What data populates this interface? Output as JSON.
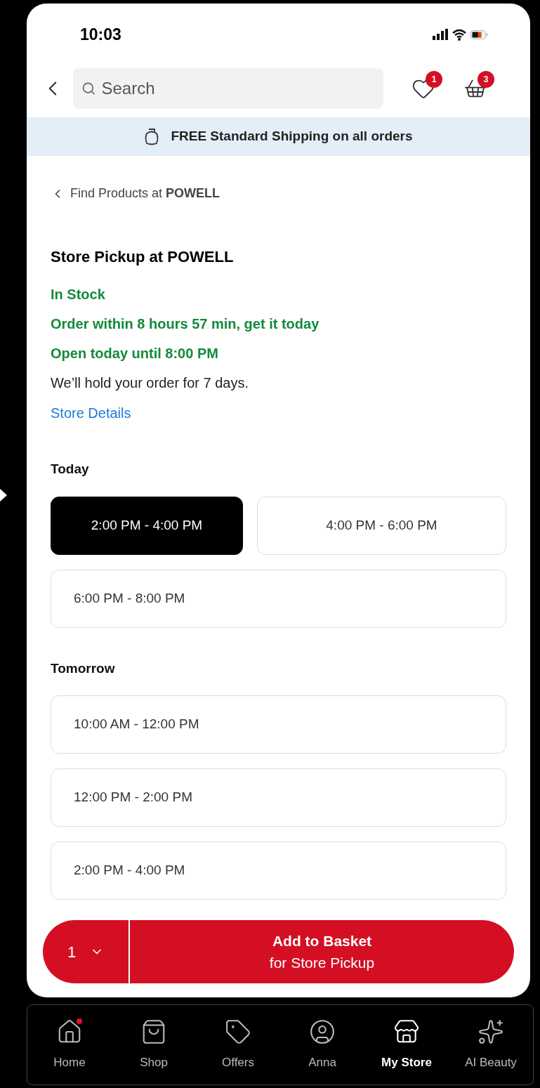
{
  "status_bar": {
    "time": "10:03"
  },
  "header": {
    "search": {
      "placeholder": "Search"
    },
    "wishlist_count": "1",
    "basket_count": "3"
  },
  "banner": {
    "text": "FREE Standard Shipping on all orders"
  },
  "breadcrumb": {
    "text": "Find Products at **POWELL**"
  },
  "pickup": {
    "title": "Store Pickup at POWELL",
    "lines": [
      {
        "text": "In Stock",
        "kind": "status"
      },
      {
        "text": "Order within 8 hours 57 min, get it today",
        "kind": "status"
      },
      {
        "text": "Open today until 8:00 PM",
        "kind": "status"
      },
      {
        "text": "We’ll hold your order for 7 days.",
        "kind": "note"
      }
    ],
    "link": "Store Details"
  },
  "days": [
    {
      "label": "Today",
      "slots": [
        {
          "label": "2:00 PM - 4:00 PM",
          "selected": true
        },
        {
          "label": "4:00 PM - 6:00 PM",
          "selected": false
        },
        {
          "label": "6:00 PM - 8:00 PM",
          "selected": false
        }
      ]
    },
    {
      "label": "Tomorrow",
      "slots": [
        {
          "label": "10:00 AM - 12:00 PM",
          "selected": false
        },
        {
          "label": "12:00 PM - 2:00 PM",
          "selected": false
        },
        {
          "label": "2:00 PM - 4:00 PM",
          "selected": false
        }
      ]
    }
  ],
  "action": {
    "quantity": "1",
    "button_line_1": "Add to Basket",
    "button_line_2": "for Store Pickup"
  },
  "tab_bar": [
    {
      "label": "Home",
      "selected": false,
      "notification": true
    },
    {
      "label": "Shop",
      "selected": false,
      "notification": false
    },
    {
      "label": "Offers",
      "selected": false,
      "notification": false
    },
    {
      "label": "Anna",
      "selected": false,
      "notification": false
    },
    {
      "label": "My Store",
      "selected": true,
      "notification": false
    },
    {
      "label": "AI Beauty",
      "selected": false,
      "notification": false
    }
  ]
}
